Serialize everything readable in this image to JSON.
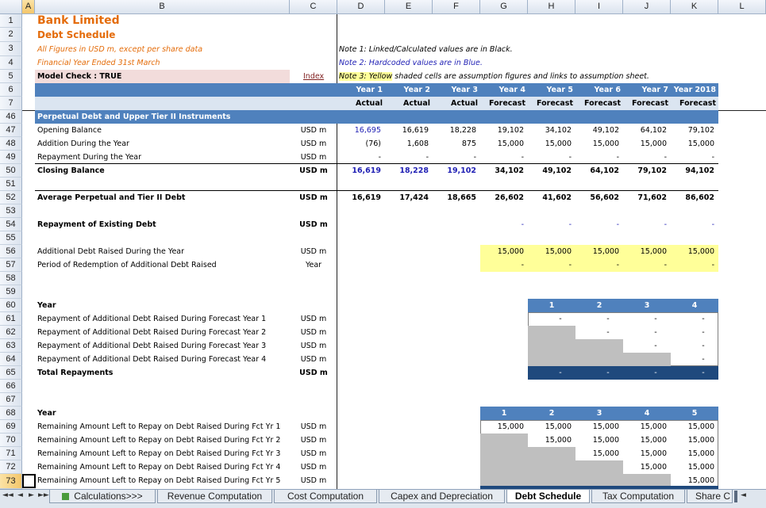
{
  "columns": [
    "A",
    "B",
    "C",
    "D",
    "E",
    "F",
    "G",
    "H",
    "I",
    "J",
    "K",
    "L"
  ],
  "rows": [
    "1",
    "2",
    "3",
    "4",
    "5",
    "6",
    "7",
    "46",
    "47",
    "48",
    "49",
    "50",
    "51",
    "52",
    "53",
    "54",
    "55",
    "56",
    "57",
    "58",
    "59",
    "60",
    "61",
    "62",
    "63",
    "64",
    "65",
    "66",
    "67",
    "68",
    "69",
    "70",
    "71",
    "72",
    "73"
  ],
  "header": {
    "company": "Bank Limited",
    "sheet_title": "Debt Schedule",
    "subtitle1": "All Figures in USD m, except per share data",
    "subtitle2": "Financial Year Ended 31st March",
    "model_check": "Model Check : TRUE",
    "index_link": "Index",
    "note1": "Note 1: Linked/Calculated values are in Black.",
    "note2": "Note 2: Hardcoded values are in Blue.",
    "note3": "Note 3: Yellow shaded cells are assumption figures and links to assumption sheet."
  },
  "years": [
    "Year 1",
    "Year 2",
    "Year 3",
    "Year 4",
    "Year 5",
    "Year 6",
    "Year 7",
    "Year 2018"
  ],
  "periods": [
    "Actual",
    "Actual",
    "Actual",
    "Forecast",
    "Forecast",
    "Forecast",
    "Forecast",
    "Forecast"
  ],
  "section_title": "Perpetual Debt and Upper Tier II Instruments",
  "labels": {
    "opening": "Opening Balance",
    "addition": "Addition During the Year",
    "repayment": "Repayment During the Year",
    "closing": "Closing Balance",
    "average": "Average Perpetual and Tier II Debt",
    "repay_existing": "Repayment of Existing Debt",
    "additional_raised": "Additional Debt Raised During the Year",
    "redemption_period": "Period of Redemption of Additional Debt Raised",
    "year": "Year",
    "repay_y1": "Repayment of Additional Debt Raised During Forecast Year 1",
    "repay_y2": "Repayment of Additional Debt Raised During Forecast Year 2",
    "repay_y3": "Repayment of Additional Debt Raised During Forecast Year 3",
    "repay_y4": "Repayment of Additional Debt Raised During Forecast Year 4",
    "total_repayments": "Total Repayments",
    "year2": "Year",
    "remain_1": "Remaining Amount Left to Repay on Debt Raised During Fct Yr 1",
    "remain_2": "Remaining Amount Left to Repay on Debt Raised During Fct Yr 2",
    "remain_3": "Remaining Amount Left to Repay on Debt Raised During Fct Yr 3",
    "remain_4": "Remaining Amount Left to Repay on Debt Raised During Fct Yr 4",
    "remain_5": "Remaining Amount Left to Repay on Debt Raised During Fct Yr 5"
  },
  "units": {
    "usd": "USD m",
    "year": "Year"
  },
  "values": {
    "opening": [
      "16,695",
      "16,619",
      "18,228",
      "19,102",
      "34,102",
      "49,102",
      "64,102",
      "79,102"
    ],
    "addition": [
      "(76)",
      "1,608",
      "875",
      "15,000",
      "15,000",
      "15,000",
      "15,000",
      "15,000"
    ],
    "repayment": [
      "-",
      "-",
      "-",
      "-",
      "-",
      "-",
      "-",
      "-"
    ],
    "closing": [
      "16,619",
      "18,228",
      "19,102",
      "34,102",
      "49,102",
      "64,102",
      "79,102",
      "94,102"
    ],
    "average": [
      "16,619",
      "17,424",
      "18,665",
      "26,602",
      "41,602",
      "56,602",
      "71,602",
      "86,602"
    ],
    "repay_existing": [
      "-",
      "-",
      "-",
      "-",
      "-"
    ],
    "additional_raised": [
      "15,000",
      "15,000",
      "15,000",
      "15,000",
      "15,000"
    ],
    "redemption_period": [
      "-",
      "-",
      "-",
      "-",
      "-"
    ],
    "table1_years": [
      "1",
      "2",
      "3",
      "4"
    ],
    "repay_y1": [
      "-",
      "-",
      "-",
      "-"
    ],
    "repay_y2": [
      "-",
      "-",
      "-"
    ],
    "repay_y3": [
      "-",
      "-"
    ],
    "repay_y4": [
      "-"
    ],
    "total_repayments": [
      "-",
      "-",
      "-",
      "-"
    ],
    "table2_years": [
      "1",
      "2",
      "3",
      "4",
      "5"
    ],
    "remain_1": [
      "15,000",
      "15,000",
      "15,000",
      "15,000",
      "15,000"
    ],
    "remain_2": [
      "15,000",
      "15,000",
      "15,000",
      "15,000"
    ],
    "remain_3": [
      "15,000",
      "15,000",
      "15,000"
    ],
    "remain_4": [
      "15,000",
      "15,000"
    ],
    "remain_5": [
      "15,000"
    ]
  },
  "tabs": [
    "Calculations>>>",
    "Revenue Computation",
    "Cost Computation",
    "Capex and Depreciation",
    "Debt Schedule",
    "Tax Computation",
    "Share C"
  ],
  "active_tab": "Debt Schedule",
  "nav": {
    "first": "◄◄",
    "prev": "◄",
    "next": "►",
    "last": "►►"
  },
  "colors": {
    "accent_orange": "#e46c0a",
    "header_blue": "#4f81bd",
    "total_dark_blue": "#1f497d",
    "assumption_yellow": "#ffff99",
    "model_check_pink": "#f2dcdb",
    "shaded_gray": "#bfbfbf",
    "hardcoded_blue": "#1f1fb4"
  }
}
